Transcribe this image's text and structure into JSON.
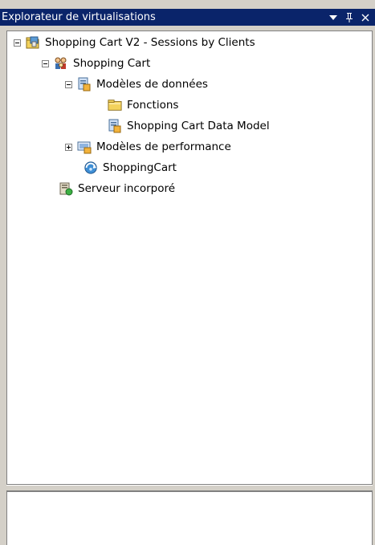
{
  "window": {
    "title": "Explorateur de virtualisations",
    "menu_glyph": "▼",
    "pin_glyph": "ᵿ",
    "close_glyph": "×"
  },
  "tree": {
    "root": "Shopping Cart V2 - Sessions by Clients",
    "shopping_cart": "Shopping Cart",
    "data_models": "Modèles de données",
    "fonctions": "Fonctions",
    "data_model": "Shopping Cart Data Model",
    "perf_models": "Modèles de performance",
    "shopping_cart_service": "ShoppingCart",
    "server": "Serveur incorporé"
  },
  "icons": {
    "root": "folder-project-icon",
    "shopping_cart": "people-icon",
    "data_models": "data-model-icon",
    "fonctions": "folder-icon",
    "data_model": "data-model-icon",
    "perf_models": "performance-model-icon",
    "shopping_cart_service": "service-icon",
    "server": "server-icon"
  },
  "colors": {
    "titlebar": "#0a246a",
    "panel": "#d4d0c8",
    "folder": "#f3d25c"
  }
}
